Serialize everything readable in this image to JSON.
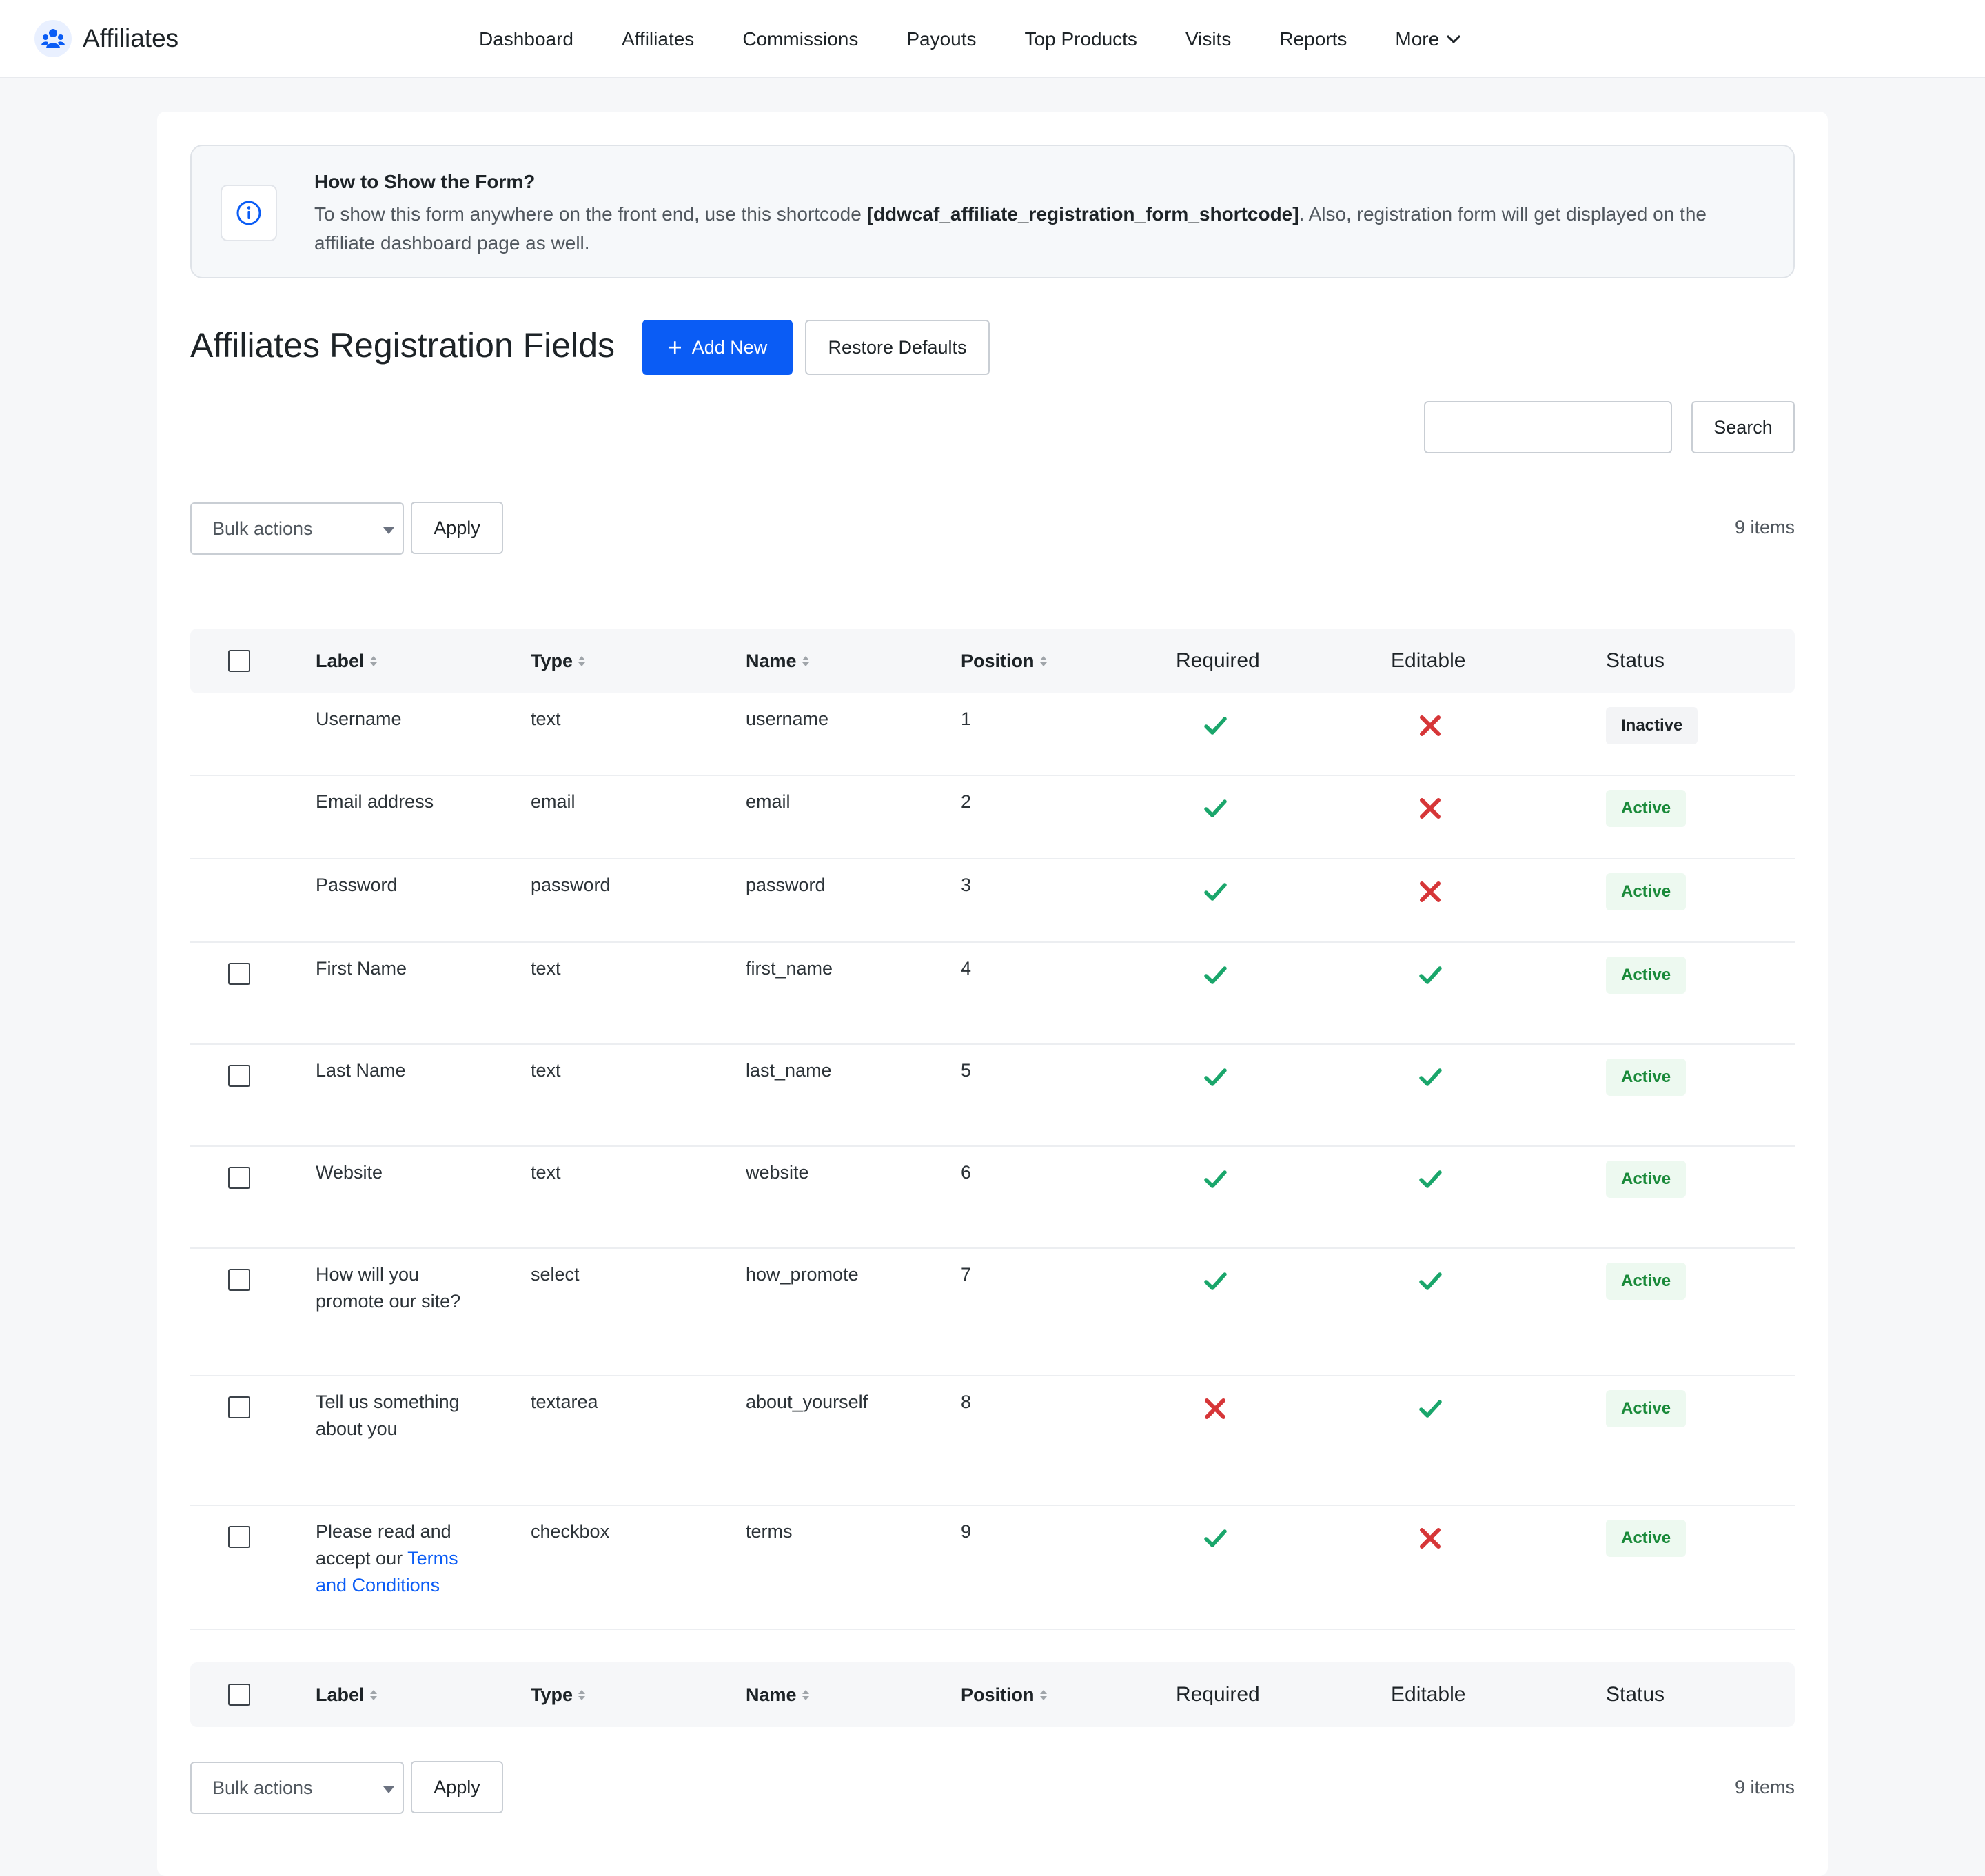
{
  "brand": {
    "name": "Affiliates"
  },
  "nav": {
    "items": [
      "Dashboard",
      "Affiliates",
      "Commissions",
      "Payouts",
      "Top Products",
      "Visits",
      "Reports"
    ],
    "more_label": "More"
  },
  "info": {
    "title": "How to Show the Form?",
    "text_before": "To show this form anywhere on the front end, use this shortcode ",
    "shortcode": "[ddwcaf_affiliate_registration_form_shortcode]",
    "text_after": ". Also, registration form will get displayed on the affiliate dashboard page as well."
  },
  "page": {
    "title": "Affiliates Registration Fields",
    "add_new_label": "Add New",
    "restore_defaults_label": "Restore Defaults"
  },
  "search": {
    "placeholder": "",
    "button_label": "Search"
  },
  "bulk": {
    "select_label": "Bulk actions",
    "apply_label": "Apply",
    "items_count": "9 items"
  },
  "table": {
    "columns": [
      "Label",
      "Type",
      "Name",
      "Position",
      "Required",
      "Editable",
      "Status"
    ],
    "rows": [
      {
        "label": "Username",
        "type": "text",
        "name": "username",
        "position": "1",
        "required": true,
        "editable": false,
        "status": "Inactive",
        "checkbox": false
      },
      {
        "label": "Email address",
        "type": "email",
        "name": "email",
        "position": "2",
        "required": true,
        "editable": false,
        "status": "Active",
        "checkbox": false
      },
      {
        "label": "Password",
        "type": "password",
        "name": "password",
        "position": "3",
        "required": true,
        "editable": false,
        "status": "Active",
        "checkbox": false
      },
      {
        "label": "First Name",
        "type": "text",
        "name": "first_name",
        "position": "4",
        "required": true,
        "editable": true,
        "status": "Active",
        "checkbox": true
      },
      {
        "label": "Last Name",
        "type": "text",
        "name": "last_name",
        "position": "5",
        "required": true,
        "editable": true,
        "status": "Active",
        "checkbox": true
      },
      {
        "label": "Website",
        "type": "text",
        "name": "website",
        "position": "6",
        "required": true,
        "editable": true,
        "status": "Active",
        "checkbox": true
      },
      {
        "label_line1": "How will you",
        "label_line2": "promote our site?",
        "type": "select",
        "name": "how_promote",
        "position": "7",
        "required": true,
        "editable": true,
        "status": "Active",
        "checkbox": true
      },
      {
        "label_line1": "Tell us something",
        "label_line2": "about you",
        "type": "textarea",
        "name": "about_yourself",
        "position": "8",
        "required": false,
        "editable": true,
        "status": "Active",
        "checkbox": true
      },
      {
        "label_line1": "Please read and",
        "label_line2": "accept our ",
        "label_link1": "Terms",
        "label_link2": "and Conditions",
        "type": "checkbox",
        "name": "terms",
        "position": "9",
        "required": true,
        "editable": false,
        "status": "Active",
        "checkbox": true
      }
    ]
  },
  "colors": {
    "primary": "#0a5cf5",
    "check": "#1aa66b",
    "cross": "#d63638",
    "active_text": "#1a8a3a",
    "active_bg": "#edf9f0"
  },
  "icons": {
    "brand": "affiliate-people-icon",
    "info": "info-circle-icon",
    "check": "check-icon",
    "cross": "cross-icon",
    "more": "chevron-down-icon",
    "add": "plus-icon"
  }
}
